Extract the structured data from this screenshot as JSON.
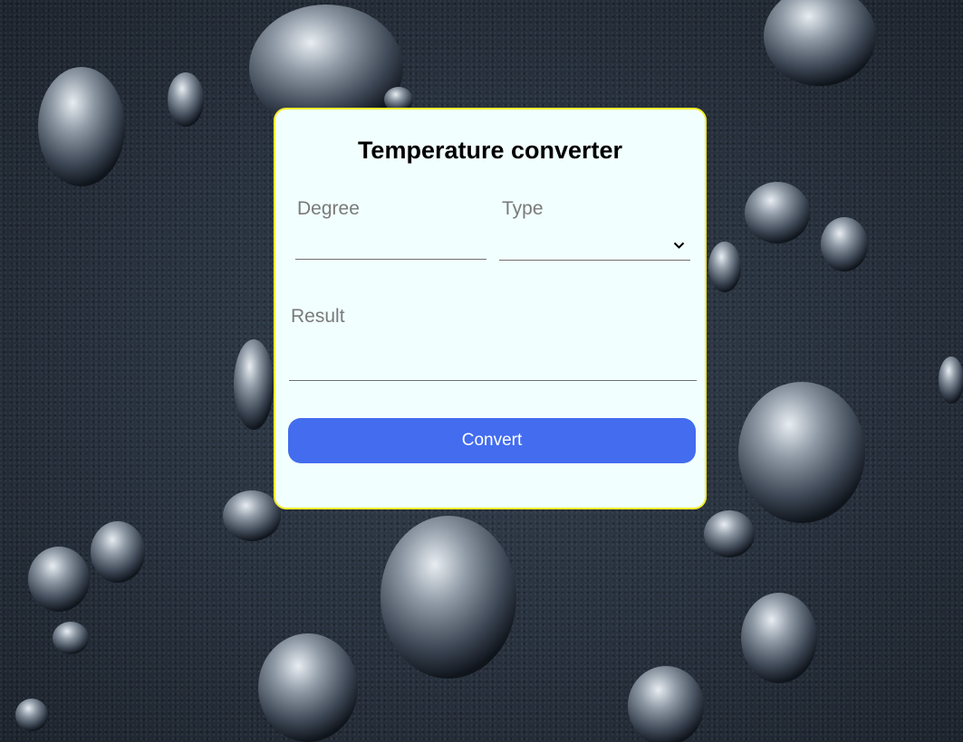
{
  "form": {
    "title": "Temperature converter",
    "degree_label": "Degree",
    "degree_value": "",
    "type_label": "Type",
    "type_value": "",
    "result_label": "Result",
    "result_value": "",
    "convert_label": "Convert"
  },
  "icons": {
    "type_dropdown": "chevron-down-icon"
  },
  "colors": {
    "card_background": "#f1fffe",
    "card_border": "#f3ec2a",
    "button": "#436cef",
    "button_text": "#ffffff",
    "label": "#7a7a7a",
    "title": "#000000"
  }
}
